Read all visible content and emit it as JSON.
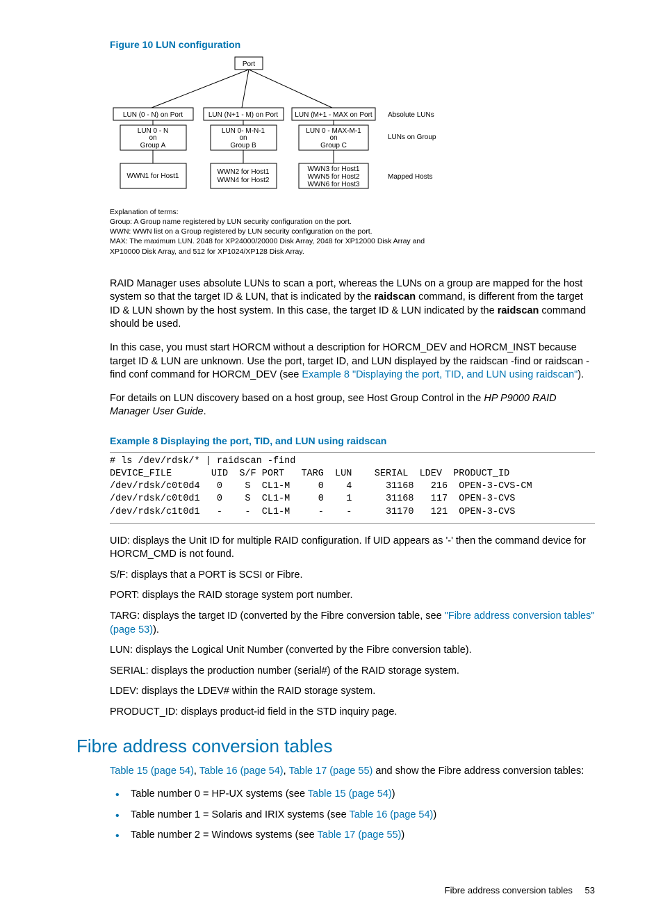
{
  "figure": {
    "caption": "Figure 10 LUN configuration",
    "port_label": "Port",
    "row1_a": "LUN (0 - N) on Port",
    "row1_b": "LUN (N+1 - M) on Port",
    "row1_c": "LUN (M+1 - MAX on Port",
    "row1_label": "Absolute LUNs",
    "row2_a1": "LUN 0 - N",
    "row2_a2": "on",
    "row2_a3": "Group A",
    "row2_b1": "LUN 0- M-N-1",
    "row2_b2": "on",
    "row2_b3": "Group B",
    "row2_c1": "LUN 0 - MAX-M-1",
    "row2_c2": "on",
    "row2_c3": "Group C",
    "row2_label": "LUNs on Group",
    "row3_a": "WWN1 for Host1",
    "row3_b1": "WWN2 for Host1",
    "row3_b2": "WWN4 for Host2",
    "row3_c1": "WWN3 for Host1",
    "row3_c2": "WWN5 for Host2",
    "row3_c3": "WWN6 for Host3",
    "row3_label": "Mapped Hosts",
    "foot_title": "Explanation of terms:",
    "foot_l1": "Group: A Group name registered by LUN security configuration on the port.",
    "foot_l2": "WWN: WWN list on a Group registered by LUN security configuration on the port.",
    "foot_l3": "MAX: The maximum LUN. 2048 for XP24000/20000 Disk Array, 2048 for XP12000 Disk Array and",
    "foot_l4": "XP10000 Disk Array, and 512 for XP1024/XP128 Disk Array."
  },
  "para1": {
    "t1": "RAID Manager uses absolute LUNs to scan a port, whereas the LUNs on a group are mapped for the host system so that the target ID & LUN, that is indicated by the ",
    "b1": "raidscan",
    "t2": " command, is different from the target ID & LUN shown by the host system. In this case, the target ID & LUN indicated by the ",
    "b2": "raidscan",
    "t3": " command should be used."
  },
  "para2": {
    "t1": "In this case, you must start HORCM without a description for HORCM_DEV and HORCM_INST because target ID & LUN are unknown. Use the port, target ID, and LUN displayed by the raidscan -find or raidscan -find conf command for HORCM_DEV (see ",
    "link": "Example 8 \"Displaying the port, TID, and LUN using raidscan\"",
    "t2": ")."
  },
  "para3": {
    "t1": "For details on LUN discovery based on a host group, see Host Group Control in the ",
    "i1": "HP P9000 RAID Manager User Guide",
    "t2": "."
  },
  "example": {
    "title": "Example 8 Displaying the port, TID, and LUN using raidscan",
    "code": "# ls /dev/rdsk/* | raidscan -find\nDEVICE_FILE       UID  S/F PORT   TARG  LUN    SERIAL  LDEV  PRODUCT_ID\n/dev/rdsk/c0t0d4   0    S  CL1-M     0    4      31168   216  OPEN-3-CVS-CM\n/dev/rdsk/c0t0d1   0    S  CL1-M     0    1      31168   117  OPEN-3-CVS\n/dev/rdsk/c1t0d1   -    -  CL1-M     -    -      31170   121  OPEN-3-CVS"
  },
  "defs": {
    "uid": "UID: displays the Unit ID for multiple RAID configuration. If UID appears as '-' then the command device for HORCM_CMD is not found.",
    "sf": "S/F: displays that a PORT is SCSI or Fibre.",
    "port": "PORT: displays the RAID storage system port number.",
    "targ_t1": "TARG: displays the target ID (converted by the Fibre conversion table, see ",
    "targ_link": "\"Fibre address conversion tables\" (page 53)",
    "targ_t2": ").",
    "lun": "LUN: displays the Logical Unit Number (converted by the Fibre conversion table).",
    "serial": "SERIAL: displays the production number (serial#) of the RAID storage system.",
    "ldev": "LDEV: displays the LDEV# within the RAID storage system.",
    "pid": "PRODUCT_ID: displays product-id field in the STD inquiry page."
  },
  "section": {
    "heading": "Fibre address conversion tables",
    "intro_link1": "Table 15 (page 54)",
    "intro_s1": ", ",
    "intro_link2": "Table 16 (page 54)",
    "intro_s2": ", ",
    "intro_link3": "Table 17 (page 55)",
    "intro_t2": " and show the Fibre address conversion tables:",
    "b1_t": "Table number 0 = HP-UX systems (see ",
    "b1_link": "Table 15 (page 54)",
    "b1_end": ")",
    "b2_t": "Table number 1 = Solaris and IRIX systems (see ",
    "b2_link": "Table 16 (page 54)",
    "b2_end": ")",
    "b3_t": "Table number 2 = Windows systems (see ",
    "b3_link": "Table 17 (page 55)",
    "b3_end": ")"
  },
  "footer": {
    "title": "Fibre address conversion tables",
    "page": "53"
  }
}
